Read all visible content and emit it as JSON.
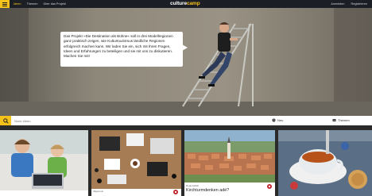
{
  "nav": {
    "items": [
      "Ideen",
      "Themen",
      "Über das Projekt"
    ],
    "logo_main": "culture",
    "logo_accent": "camp",
    "right": [
      "Anmelden",
      "Registrieren"
    ]
  },
  "hero": {
    "bubble_text": "Das Projekt »Die Destination als Bühne« soll in drei Modellregionen ganz praktisch zeigen, wie Kulturtourismus ländliche Regionen erfolgreich machen kann. Wir laden Sie ein, sich mit Ihren Fragen, Ideen und Erfahrungen zu beteiligen und sie mit uns zu diskutieren. Machen Sie mit!"
  },
  "search": {
    "placeholder": "Noch Ideen",
    "tab_new": "Neu",
    "tab_topics": "Themen"
  },
  "cards": [
    {
      "meta": "",
      "title": ""
    },
    {
      "meta": "Allgemein",
      "title": ""
    },
    {
      "meta": "Regionalität",
      "title": "Kirchturmdenken adé?"
    },
    {
      "meta": "",
      "title": ""
    }
  ],
  "colors": {
    "accent": "#f4c21a",
    "nav_bg": "#1b1e24",
    "badge": "#c1272d"
  },
  "icons": [
    "menu-icon",
    "search-icon",
    "new-icon",
    "topics-icon"
  ]
}
